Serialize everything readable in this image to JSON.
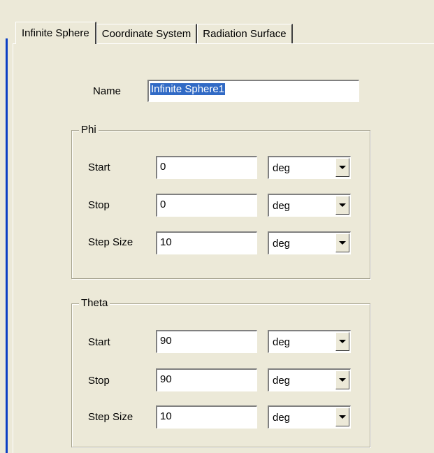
{
  "tabs": [
    {
      "label": "Infinite Sphere",
      "active": true
    },
    {
      "label": "Coordinate System",
      "active": false
    },
    {
      "label": "Radiation Surface",
      "active": false
    }
  ],
  "name": {
    "label": "Name",
    "value": "Infinite Sphere1"
  },
  "phi": {
    "title": "Phi",
    "start": {
      "label": "Start",
      "value": "0",
      "unit": "deg"
    },
    "stop": {
      "label": "Stop",
      "value": "0",
      "unit": "deg"
    },
    "step": {
      "label": "Step Size",
      "value": "10",
      "unit": "deg"
    }
  },
  "theta": {
    "title": "Theta",
    "start": {
      "label": "Start",
      "value": "90",
      "unit": "deg"
    },
    "stop": {
      "label": "Stop",
      "value": "90",
      "unit": "deg"
    },
    "step": {
      "label": "Step Size",
      "value": "10",
      "unit": "deg"
    }
  }
}
